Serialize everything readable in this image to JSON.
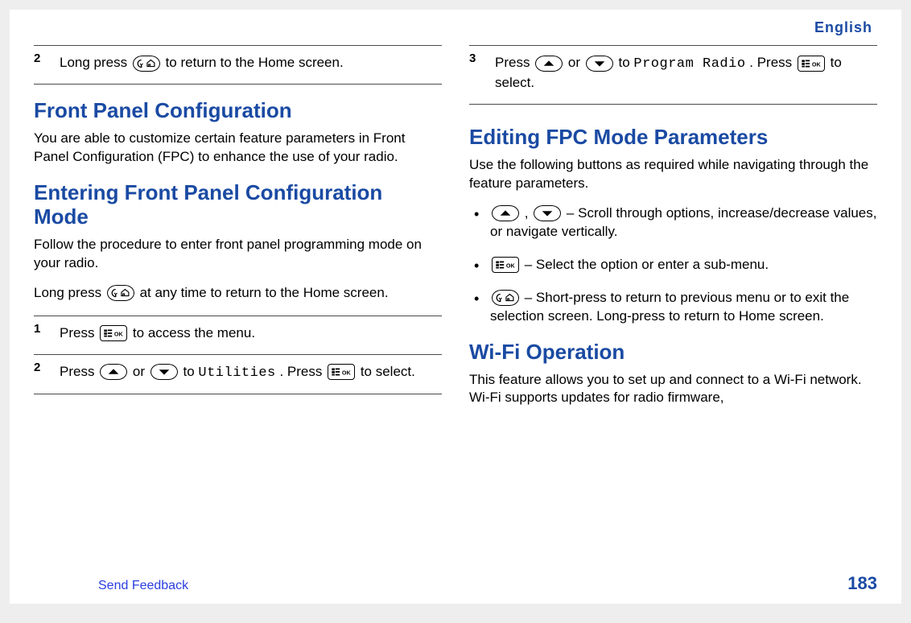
{
  "header": {
    "language": "English"
  },
  "left": {
    "step2_prev": {
      "num": "2",
      "pre": "Long press ",
      "post": " to return to the Home screen."
    },
    "fpc": {
      "title": "Front Panel Configuration",
      "intro": "You are able to customize certain feature parameters in Front Panel Configuration (FPC) to enhance the use of your radio."
    },
    "entering": {
      "title": "Entering Front Panel Configuration Mode",
      "intro": "Follow the procedure to enter front panel programming mode on your radio.",
      "note_pre": "Long press ",
      "note_post": " at any time to return to the Home screen.",
      "steps": [
        {
          "num": "1",
          "pre": "Press ",
          "post": " to access the menu."
        },
        {
          "num": "2",
          "pre": "Press ",
          "mid1": " or ",
          "mid2": " to ",
          "mono": "Utilities",
          "post1": ". Press ",
          "post2": " to select."
        }
      ]
    }
  },
  "right": {
    "step3": {
      "num": "3",
      "pre": "Press ",
      "mid1": " or ",
      "mid2": " to ",
      "mono": "Program Radio",
      "post1": ". Press ",
      "post2": " to select."
    },
    "editing": {
      "title": "Editing FPC Mode Parameters",
      "intro": "Use the following buttons as required while navigating through the feature parameters.",
      "bullets": [
        {
          "pre": "",
          "between": " , ",
          "post": " – Scroll through options, increase/decrease values, or navigate vertically."
        },
        {
          "pre": "",
          "post": " – Select the option or enter a sub-menu."
        },
        {
          "pre": "",
          "post": " – Short-press to return to previous menu or to exit the selection screen. Long-press to return to Home screen."
        }
      ]
    },
    "wifi": {
      "title": "Wi-Fi Operation",
      "intro": "This feature allows you to set up and connect to a Wi-Fi network. Wi-Fi supports updates for radio firmware,"
    }
  },
  "footer": {
    "feedback": "Send Feedback",
    "page": "183"
  },
  "icons": {
    "back_home": "back-home-icon",
    "menu_ok": "menu-ok-icon",
    "up": "up-arrow-icon",
    "down": "down-arrow-icon"
  }
}
